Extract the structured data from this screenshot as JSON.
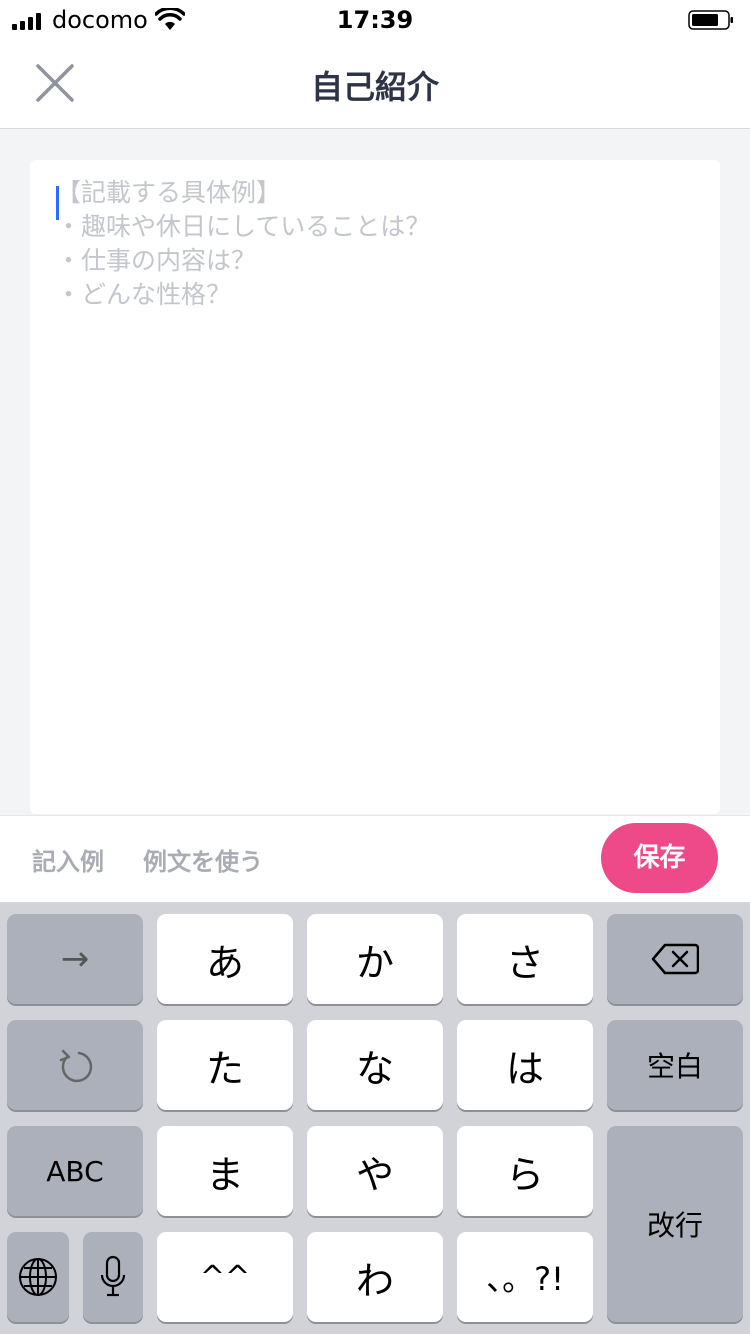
{
  "status_bar": {
    "carrier": "docomo",
    "time": "17:39"
  },
  "nav": {
    "title": "自己紹介",
    "close_icon": "close-icon"
  },
  "editor": {
    "placeholder": "【記載する具体例】\n・趣味や休日にしていることは？\n・仕事の内容は？\n・どんな性格？"
  },
  "toolbar": {
    "example_label": "記入例",
    "use_example_label": "例文を使う",
    "save_label": "保存"
  },
  "keyboard": {
    "row1": [
      "あ",
      "か",
      "さ"
    ],
    "row2": [
      "た",
      "な",
      "は"
    ],
    "row3": [
      "ま",
      "や",
      "ら"
    ],
    "row4": [
      "^^",
      "わ",
      "、。?!"
    ],
    "space_label": "空白",
    "return_label": "改行",
    "abc_label": "ABC",
    "arrow_label": "→"
  },
  "colors": {
    "accent": "#ee4a8a",
    "title": "#2e3446",
    "background": "#f3f4f6",
    "keyboard": "#d1d3d9"
  }
}
